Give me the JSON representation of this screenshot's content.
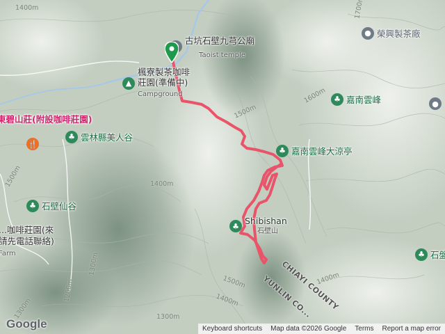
{
  "map": {
    "pois": [
      {
        "name": "古坑石壁九芎公廟",
        "sub": "Taoist temple",
        "kind": "grey",
        "icon": "place-of-worship-icon"
      },
      {
        "name": "楓寮製茶咖啡莊園(準備中)",
        "sub": "Campground",
        "kind": "green",
        "icon": "campground-icon"
      },
      {
        "name": "榮興製茶廠",
        "kind": "grey",
        "icon": "place-icon"
      },
      {
        "name": "嘉南雲峰",
        "kind": "green",
        "icon": "park-icon"
      },
      {
        "name": "東碧山莊(附設咖啡莊園)",
        "kind": "pink",
        "icon": "lodging-pin-icon"
      },
      {
        "name": "雲林縣美人谷",
        "kind": "green",
        "icon": "park-icon"
      },
      {
        "name": "嘉南雲峰大涼亭",
        "kind": "green",
        "icon": "park-icon"
      },
      {
        "name": "石壁仙谷",
        "kind": "green",
        "icon": "park-icon"
      },
      {
        "name": "...咖啡莊園(來",
        "line2": "請先電話聯絡)",
        "sub": "Farm",
        "kind": "grey",
        "icon": "farm-icon"
      },
      {
        "name": "Shibishan",
        "sub": "石壁山",
        "kind": "green",
        "icon": "peak-icon"
      },
      {
        "name": "石盤",
        "kind": "green",
        "icon": "park-icon"
      }
    ],
    "contours": [
      "1400m",
      "1500m",
      "1600m",
      "1700m",
      "1400m",
      "1300m",
      "1200m",
      "1300m",
      "1500m",
      "1400m",
      "1300m",
      "1500m",
      "1400m"
    ],
    "roads": [
      "CHIAYI COUNTY",
      "YUNLIN CO..."
    ],
    "route_color": "#e8556a",
    "water_color": "#a6c8e8"
  },
  "footer": {
    "logo": "Google",
    "shortcuts": "Keyboard shortcuts",
    "data": "Map data ©2026 Google",
    "terms": "Terms",
    "report": "Report a map error"
  }
}
